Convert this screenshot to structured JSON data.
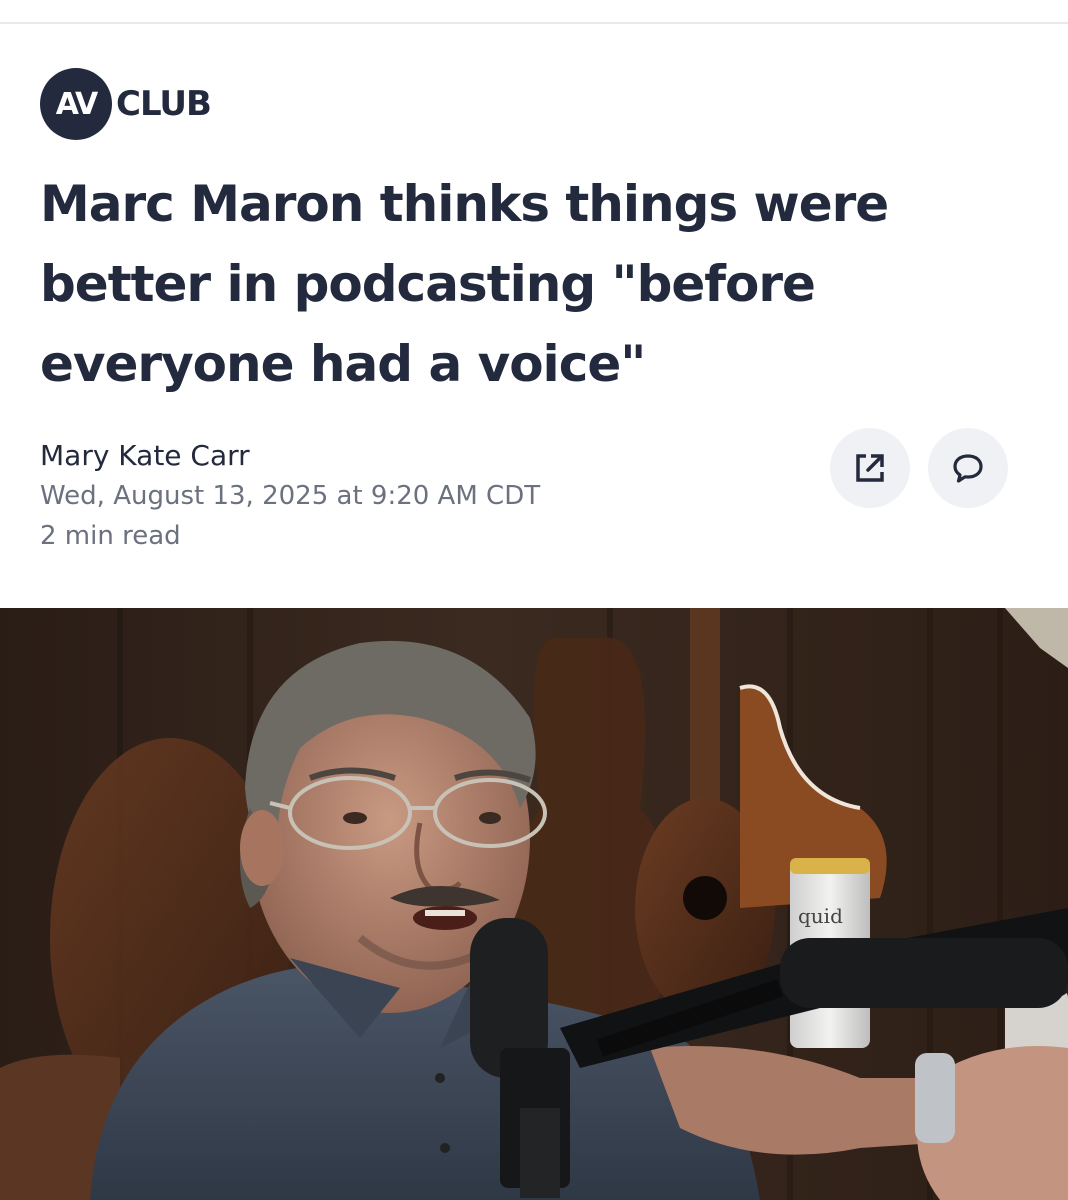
{
  "brand": {
    "badge_text": "AV",
    "name_text": "CLUB",
    "color": "#232a3d"
  },
  "article": {
    "headline": "Marc Maron thinks things were better in podcasting \"before everyone had a voice\"",
    "author": "Mary Kate Carr",
    "timestamp": "Wed, August 13, 2025 at 9:20 AM CDT",
    "read_time": "2 min read"
  },
  "actions": {
    "share_icon": "external-link-icon",
    "comment_icon": "speech-bubble-icon"
  },
  "hero_image": {
    "description_icon": "photo",
    "can_label": "quid"
  }
}
